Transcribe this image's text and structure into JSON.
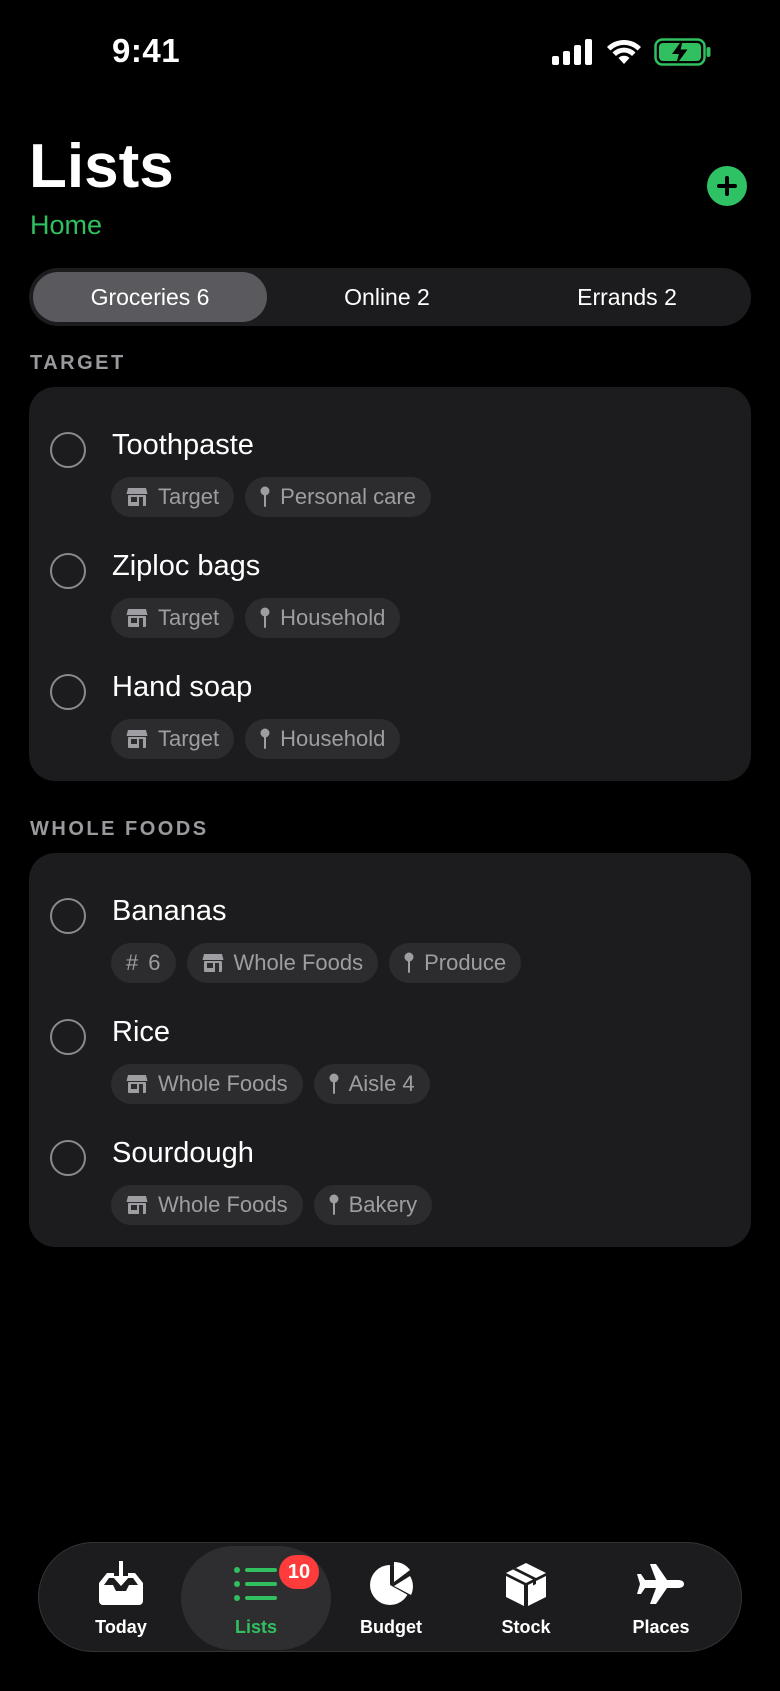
{
  "status_bar": {
    "time": "9:41"
  },
  "header": {
    "title": "Lists",
    "subtitle": "Home"
  },
  "segments": [
    {
      "label": "Groceries 6",
      "active": true
    },
    {
      "label": "Online 2",
      "active": false
    },
    {
      "label": "Errands 2",
      "active": false
    }
  ],
  "sections": [
    {
      "header": "TARGET",
      "items": [
        {
          "title": "Toothpaste",
          "store": "Target",
          "location": "Personal care"
        },
        {
          "title": "Ziploc bags",
          "store": "Target",
          "location": "Household"
        },
        {
          "title": "Hand soap",
          "store": "Target",
          "location": "Household"
        }
      ]
    },
    {
      "header": "WHOLE FOODS",
      "items": [
        {
          "title": "Bananas",
          "quantity": "6",
          "store": "Whole Foods",
          "location": "Produce"
        },
        {
          "title": "Rice",
          "store": "Whole Foods",
          "location": "Aisle 4"
        },
        {
          "title": "Sourdough",
          "store": "Whole Foods",
          "location": "Bakery"
        }
      ]
    }
  ],
  "tab_bar": {
    "tabs": [
      {
        "label": "Today",
        "icon": "inbox-tray-icon"
      },
      {
        "label": "Lists",
        "icon": "list-icon",
        "badge": "10",
        "active": true
      },
      {
        "label": "Budget",
        "icon": "pie-chart-icon"
      },
      {
        "label": "Stock",
        "icon": "box-icon"
      },
      {
        "label": "Places",
        "icon": "airplane-icon"
      }
    ]
  },
  "colors": {
    "accent": "#30c060",
    "badge": "#ff3b3b",
    "card": "#1c1c1e",
    "tag": "#2c2c2e"
  }
}
